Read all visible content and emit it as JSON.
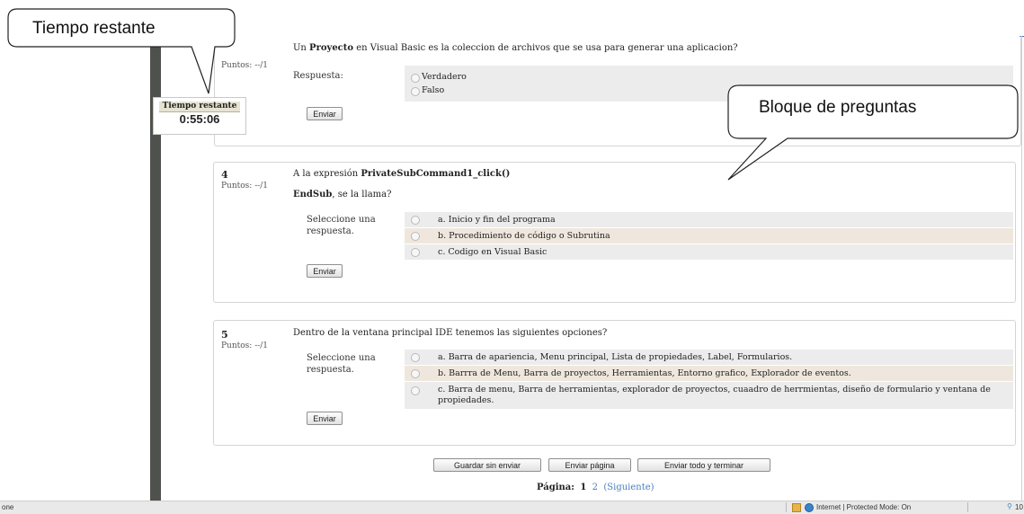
{
  "callouts": {
    "timer": "Tiempo restante",
    "questions": "Bloque de preguntas"
  },
  "timer": {
    "heading": "Tiempo restante",
    "value": "0:55:06"
  },
  "questions": [
    {
      "number": "",
      "points": "Puntos: --/1",
      "text_parts": [
        "Un ",
        "Proyecto",
        " en Visual Basic es la coleccion de archivos que se usa para generar una aplicacion?"
      ],
      "answer_label": "Respuesta:",
      "options": [
        "Verdadero",
        "Falso"
      ],
      "submit_label": "Enviar"
    },
    {
      "number": "4",
      "points": "Puntos: --/1",
      "text_line1_parts": [
        "A la expresión ",
        "PrivateSubCommand1_click()"
      ],
      "text_line2_parts": [
        "EndSub",
        ", se la llama?"
      ],
      "answer_label": "Seleccione una respuesta.",
      "options": [
        "a. Inicio y fin del programa",
        "b. Procedimiento de código o Subrutina",
        "c. Codigo en Visual Basic"
      ],
      "submit_label": "Enviar"
    },
    {
      "number": "5",
      "points": "Puntos: --/1",
      "text": "Dentro de la ventana principal IDE tenemos las siguientes opciones?",
      "answer_label": "Seleccione una respuesta.",
      "options": [
        "a. Barra de apariencia, Menu principal, Lista de propiedades, Label, Formularios.",
        "b. Barrra de Menu, Barra de proyectos, Herramientas, Entorno grafico, Explorador de eventos.",
        "c. Barra de menu, Barra de herramientas, explorador de proyectos, cuaadro de herrmientas, diseño de formulario y ventana de propiedades."
      ],
      "submit_label": "Enviar"
    }
  ],
  "footer": {
    "buttons": [
      "Guardar sin enviar",
      "Enviar página",
      "Enviar todo y terminar"
    ],
    "pagination_label": "Página:",
    "page_1": "1",
    "page_2": "2",
    "next": "(Siguiente)"
  },
  "status_bar": {
    "left": "one",
    "zone": "Internet | Protected Mode: On",
    "zoom": "10"
  }
}
